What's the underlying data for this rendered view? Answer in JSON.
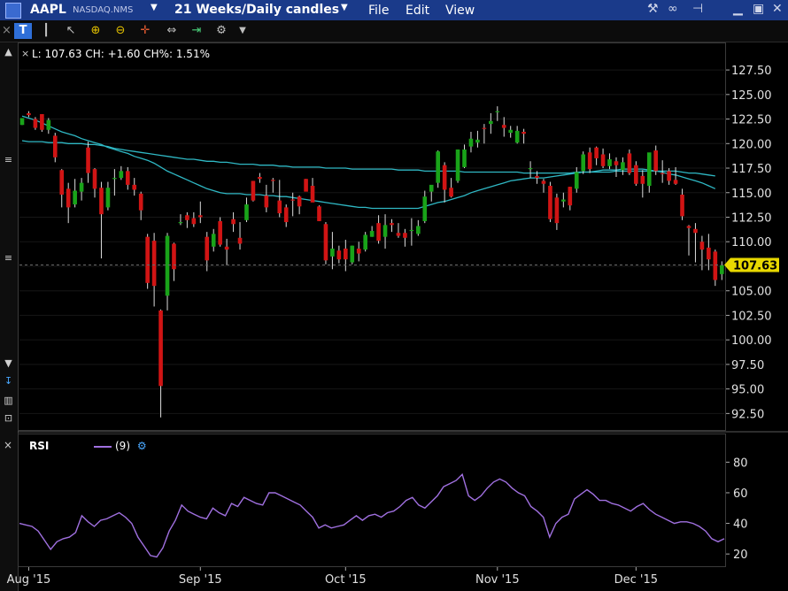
{
  "header": {
    "symbol": "AAPL",
    "exchange": "NASDAQ.NMS",
    "timeframe": "21 Weeks/Daily candles",
    "menu": {
      "file": "File",
      "edit": "Edit",
      "view": "View"
    },
    "menu_caret": "▼"
  },
  "toolbar": {
    "icons": [
      "text-tool-icon",
      "bar-style-icon",
      "pointer-icon",
      "zoom-in-icon",
      "zoom-out-icon",
      "crosshair-icon",
      "pan-icon",
      "fit-icon",
      "wrench-icon",
      "dropdown-icon"
    ]
  },
  "info_line": "L: 107.63 CH: +1.60 CH%: 1.51%",
  "price_badge": "107.63",
  "rsi_panel": {
    "label": "RSI",
    "param": "(9)"
  },
  "colors": {
    "bull": "#19a319",
    "bear": "#d11414",
    "ma": "#2fb8c4",
    "rsi": "#a070e0",
    "badge": "#e8d800"
  },
  "chart_data": [
    {
      "type": "candlestick",
      "title": "",
      "ylim": [
        91.0,
        128.5
      ],
      "y_ticks": [
        "127.50",
        "125.00",
        "122.50",
        "120.00",
        "117.50",
        "115.00",
        "112.50",
        "110.00",
        "107.50",
        "105.00",
        "102.50",
        "100.00",
        "97.50",
        "95.00",
        "92.50"
      ],
      "x_ticks": [
        "Aug '15",
        "Sep '15",
        "Oct '15",
        "Nov '15",
        "Dec '15"
      ],
      "x_tick_index": [
        1,
        27,
        49,
        72,
        93
      ],
      "last_price": 107.63,
      "candles": [
        [
          121.9,
          122.6,
          121.9,
          122.6
        ],
        [
          123.1,
          123.3,
          122.7,
          122.9
        ],
        [
          122.5,
          122.7,
          121.4,
          121.6
        ],
        [
          123.0,
          123.0,
          121.2,
          121.4
        ],
        [
          121.4,
          122.6,
          121.0,
          122.4
        ],
        [
          120.8,
          121.1,
          118.1,
          118.6
        ],
        [
          117.3,
          117.4,
          113.5,
          114.8
        ],
        [
          115.4,
          116.0,
          111.9,
          113.5
        ],
        [
          113.8,
          116.4,
          113.5,
          115.2
        ],
        [
          115.1,
          116.5,
          114.2,
          116.0
        ],
        [
          119.6,
          120.2,
          116.0,
          117.0
        ],
        [
          117.4,
          117.5,
          114.5,
          115.4
        ],
        [
          115.5,
          116.1,
          108.3,
          112.8
        ],
        [
          113.5,
          116.1,
          113.2,
          115.5
        ],
        [
          116.4,
          117.4,
          114.7,
          116.5
        ],
        [
          116.5,
          117.7,
          116.3,
          117.2
        ],
        [
          117.2,
          117.6,
          115.3,
          115.8
        ],
        [
          115.8,
          116.5,
          114.7,
          115.3
        ],
        [
          114.9,
          115.1,
          112.2,
          113.2
        ],
        [
          110.5,
          110.8,
          105.2,
          105.8
        ],
        [
          110.1,
          110.9,
          103.4,
          105.5
        ],
        [
          103.0,
          103.1,
          92.1,
          95.3
        ],
        [
          104.5,
          110.9,
          103.0,
          110.6
        ],
        [
          109.8,
          109.9,
          106.0,
          107.2
        ],
        [
          112.0,
          112.8,
          111.7,
          112.0
        ],
        [
          112.7,
          113.0,
          111.4,
          112.2
        ],
        [
          112.4,
          113.0,
          111.5,
          111.8
        ],
        [
          112.7,
          114.1,
          111.9,
          112.5
        ],
        [
          110.5,
          111.0,
          107.0,
          108.1
        ],
        [
          109.5,
          111.3,
          109.0,
          110.8
        ],
        [
          112.1,
          112.5,
          109.5,
          109.7
        ],
        [
          109.5,
          110.3,
          107.6,
          109.2
        ],
        [
          112.3,
          113.0,
          111.0,
          111.8
        ],
        [
          110.4,
          112.0,
          109.2,
          109.8
        ],
        [
          112.2,
          114.5,
          112.0,
          113.8
        ],
        [
          116.2,
          116.2,
          114.1,
          114.2
        ],
        [
          116.6,
          117.0,
          116.0,
          116.4
        ],
        [
          114.7,
          115.8,
          113.0,
          113.5
        ],
        [
          116.3,
          116.5,
          115.0,
          116.2
        ],
        [
          114.2,
          116.3,
          112.5,
          112.9
        ],
        [
          113.5,
          113.8,
          111.5,
          112.0
        ],
        [
          114.3,
          115.0,
          112.6,
          114.2
        ],
        [
          114.6,
          114.7,
          112.8,
          113.6
        ],
        [
          116.4,
          116.4,
          115.2,
          115.1
        ],
        [
          115.7,
          116.5,
          114.3,
          114.0
        ],
        [
          113.6,
          113.7,
          112.1,
          112.1
        ],
        [
          111.8,
          112.0,
          107.7,
          108.1
        ],
        [
          108.5,
          111.0,
          107.2,
          109.3
        ],
        [
          109.1,
          109.6,
          107.8,
          108.2
        ],
        [
          109.3,
          110.2,
          107.0,
          108.2
        ],
        [
          107.9,
          109.6,
          107.7,
          109.6
        ],
        [
          109.3,
          110.0,
          108.0,
          108.8
        ],
        [
          109.2,
          111.0,
          109.0,
          110.7
        ],
        [
          110.5,
          111.6,
          110.5,
          111.1
        ],
        [
          111.9,
          112.7,
          109.8,
          110.1
        ],
        [
          110.5,
          112.8,
          109.3,
          111.7
        ],
        [
          111.9,
          112.3,
          111.0,
          111.7
        ],
        [
          110.9,
          111.9,
          110.4,
          110.6
        ],
        [
          110.9,
          111.3,
          109.5,
          110.4
        ],
        [
          111.1,
          112.4,
          109.6,
          111.2
        ],
        [
          110.8,
          112.2,
          110.6,
          111.6
        ],
        [
          112.1,
          115.2,
          111.9,
          114.6
        ],
        [
          115.1,
          115.7,
          114.1,
          115.8
        ],
        [
          116.0,
          119.3,
          115.5,
          119.2
        ],
        [
          117.8,
          118.1,
          114.0,
          115.3
        ],
        [
          115.5,
          116.5,
          114.5,
          114.6
        ],
        [
          116.2,
          119.4,
          116.0,
          119.4
        ],
        [
          117.6,
          119.9,
          117.5,
          119.4
        ],
        [
          119.7,
          121.2,
          119.1,
          120.5
        ],
        [
          120.1,
          121.3,
          119.6,
          120.4
        ],
        [
          121.6,
          122.0,
          120.0,
          121.5
        ],
        [
          122.0,
          123.1,
          121.0,
          122.3
        ],
        [
          123.2,
          123.8,
          122.3,
          123.3
        ],
        [
          121.9,
          122.7,
          120.7,
          121.6
        ],
        [
          121.1,
          121.8,
          120.6,
          121.4
        ],
        [
          120.1,
          121.8,
          120.0,
          121.3
        ],
        [
          121.2,
          121.5,
          120.0,
          121.0
        ],
        [
          117.5,
          118.2,
          116.5,
          117.5
        ],
        [
          116.7,
          117.2,
          115.9,
          116.5
        ],
        [
          116.2,
          116.4,
          115.0,
          115.9
        ],
        [
          115.7,
          116.1,
          112.0,
          112.3
        ],
        [
          114.5,
          114.9,
          111.2,
          111.9
        ],
        [
          114.1,
          115.0,
          113.5,
          114.3
        ],
        [
          115.6,
          115.6,
          113.2,
          113.7
        ],
        [
          115.4,
          117.6,
          115.0,
          117.1
        ],
        [
          117.2,
          119.2,
          116.9,
          118.9
        ],
        [
          119.1,
          119.6,
          117.0,
          117.4
        ],
        [
          119.6,
          119.7,
          117.8,
          118.5
        ],
        [
          118.9,
          119.5,
          117.5,
          117.7
        ],
        [
          117.7,
          119.0,
          117.4,
          118.4
        ],
        [
          118.2,
          118.6,
          116.6,
          117.8
        ],
        [
          117.3,
          118.6,
          116.8,
          118.1
        ],
        [
          119.0,
          119.4,
          116.8,
          117.0
        ],
        [
          117.8,
          118.2,
          115.7,
          115.9
        ],
        [
          116.7,
          117.3,
          114.5,
          115.9
        ],
        [
          115.7,
          119.0,
          115.0,
          119.1
        ],
        [
          119.3,
          119.8,
          116.8,
          117.2
        ],
        [
          117.0,
          118.3,
          116.0,
          116.9
        ],
        [
          117.2,
          117.5,
          115.8,
          116.2
        ],
        [
          116.3,
          117.6,
          115.8,
          115.9
        ],
        [
          114.8,
          115.4,
          112.2,
          112.6
        ],
        [
          111.6,
          111.7,
          108.6,
          111.4
        ],
        [
          111.3,
          111.9,
          107.9,
          110.9
        ],
        [
          110.0,
          110.6,
          107.1,
          109.2
        ],
        [
          109.4,
          110.8,
          107.1,
          108.2
        ],
        [
          109.0,
          109.2,
          105.5,
          106.1
        ],
        [
          106.7,
          108.0,
          106.1,
          107.6
        ]
      ],
      "ma_series": [
        {
          "values": [
            122.8,
            122.6,
            122.4,
            122.1,
            121.8,
            121.5,
            121.2,
            121.0,
            120.8,
            120.5,
            120.3,
            120.1,
            119.9,
            119.6,
            119.4,
            119.2,
            119.0,
            118.7,
            118.5,
            118.3,
            118.0,
            117.6,
            117.2,
            116.9,
            116.6,
            116.3,
            116.0,
            115.7,
            115.4,
            115.2,
            115.0,
            114.9,
            114.9,
            114.9,
            114.8,
            114.8,
            114.8,
            114.7,
            114.7,
            114.6,
            114.6,
            114.5,
            114.4,
            114.3,
            114.2,
            114.1,
            114.0,
            113.9,
            113.8,
            113.7,
            113.6,
            113.5,
            113.5,
            113.4,
            113.4,
            113.4,
            113.4,
            113.4,
            113.4,
            113.4,
            113.4,
            113.6,
            113.8,
            114.0,
            114.1,
            114.3,
            114.5,
            114.7,
            115.0,
            115.2,
            115.4,
            115.6,
            115.8,
            116.0,
            116.2,
            116.3,
            116.4,
            116.5,
            116.5,
            116.5,
            116.6,
            116.7,
            116.8,
            116.9,
            117.0,
            117.1,
            117.1,
            117.2,
            117.3,
            117.3,
            117.3,
            117.4,
            117.4,
            117.4,
            117.4,
            117.3,
            117.2,
            117.1,
            116.9,
            116.8,
            116.6,
            116.4,
            116.2,
            116.0,
            115.7,
            115.4
          ]
        },
        {
          "values": [
            120.3,
            120.2,
            120.2,
            120.2,
            120.1,
            120.1,
            120.1,
            120.0,
            120.0,
            120.0,
            119.9,
            119.9,
            119.8,
            119.7,
            119.5,
            119.4,
            119.3,
            119.2,
            119.1,
            119.0,
            118.9,
            118.8,
            118.7,
            118.6,
            118.5,
            118.4,
            118.4,
            118.3,
            118.2,
            118.2,
            118.1,
            118.1,
            118.0,
            117.9,
            117.9,
            117.9,
            117.8,
            117.8,
            117.8,
            117.7,
            117.7,
            117.6,
            117.6,
            117.6,
            117.6,
            117.6,
            117.5,
            117.5,
            117.5,
            117.5,
            117.4,
            117.4,
            117.4,
            117.4,
            117.4,
            117.4,
            117.4,
            117.3,
            117.3,
            117.3,
            117.3,
            117.2,
            117.2,
            117.2,
            117.2,
            117.2,
            117.2,
            117.1,
            117.1,
            117.1,
            117.1,
            117.1,
            117.1,
            117.1,
            117.1,
            117.1,
            117.0,
            117.0,
            117.0,
            117.0,
            117.0,
            117.0,
            117.0,
            117.0,
            117.1,
            117.1,
            117.1,
            117.1,
            117.1,
            117.1,
            117.2,
            117.2,
            117.2,
            117.2,
            117.2,
            117.2,
            117.2,
            117.2,
            117.2,
            117.2,
            117.1,
            117.0,
            117.0,
            116.9,
            116.8,
            116.7
          ]
        }
      ]
    },
    {
      "type": "line",
      "title": "RSI",
      "ylim": [
        12,
        86
      ],
      "y_ticks": [
        80,
        60,
        40,
        20
      ],
      "series": [
        {
          "name": "RSI",
          "values": [
            40,
            39,
            38,
            35,
            29,
            23,
            28,
            30,
            31,
            34,
            45,
            41,
            38,
            42,
            43,
            45,
            47,
            44,
            40,
            31,
            25,
            19,
            18,
            24,
            35,
            42,
            52,
            48,
            46,
            44,
            43,
            50,
            47,
            45,
            53,
            51,
            57,
            55,
            53,
            52,
            60,
            60,
            58,
            56,
            54,
            52,
            48,
            44,
            37,
            39,
            37,
            38,
            39,
            42,
            45,
            42,
            45,
            46,
            44,
            47,
            48,
            51,
            55,
            57,
            52,
            50,
            54,
            58,
            64,
            66,
            68,
            72,
            58,
            55,
            58,
            63,
            67,
            69,
            67,
            63,
            60,
            58,
            51,
            48,
            44,
            31,
            40,
            44,
            46,
            56,
            59,
            62,
            59,
            55,
            55,
            53,
            52,
            50,
            48,
            51,
            53,
            49,
            46,
            44,
            42,
            40,
            41,
            41,
            40,
            38,
            35,
            30,
            28,
            30
          ]
        }
      ]
    }
  ]
}
